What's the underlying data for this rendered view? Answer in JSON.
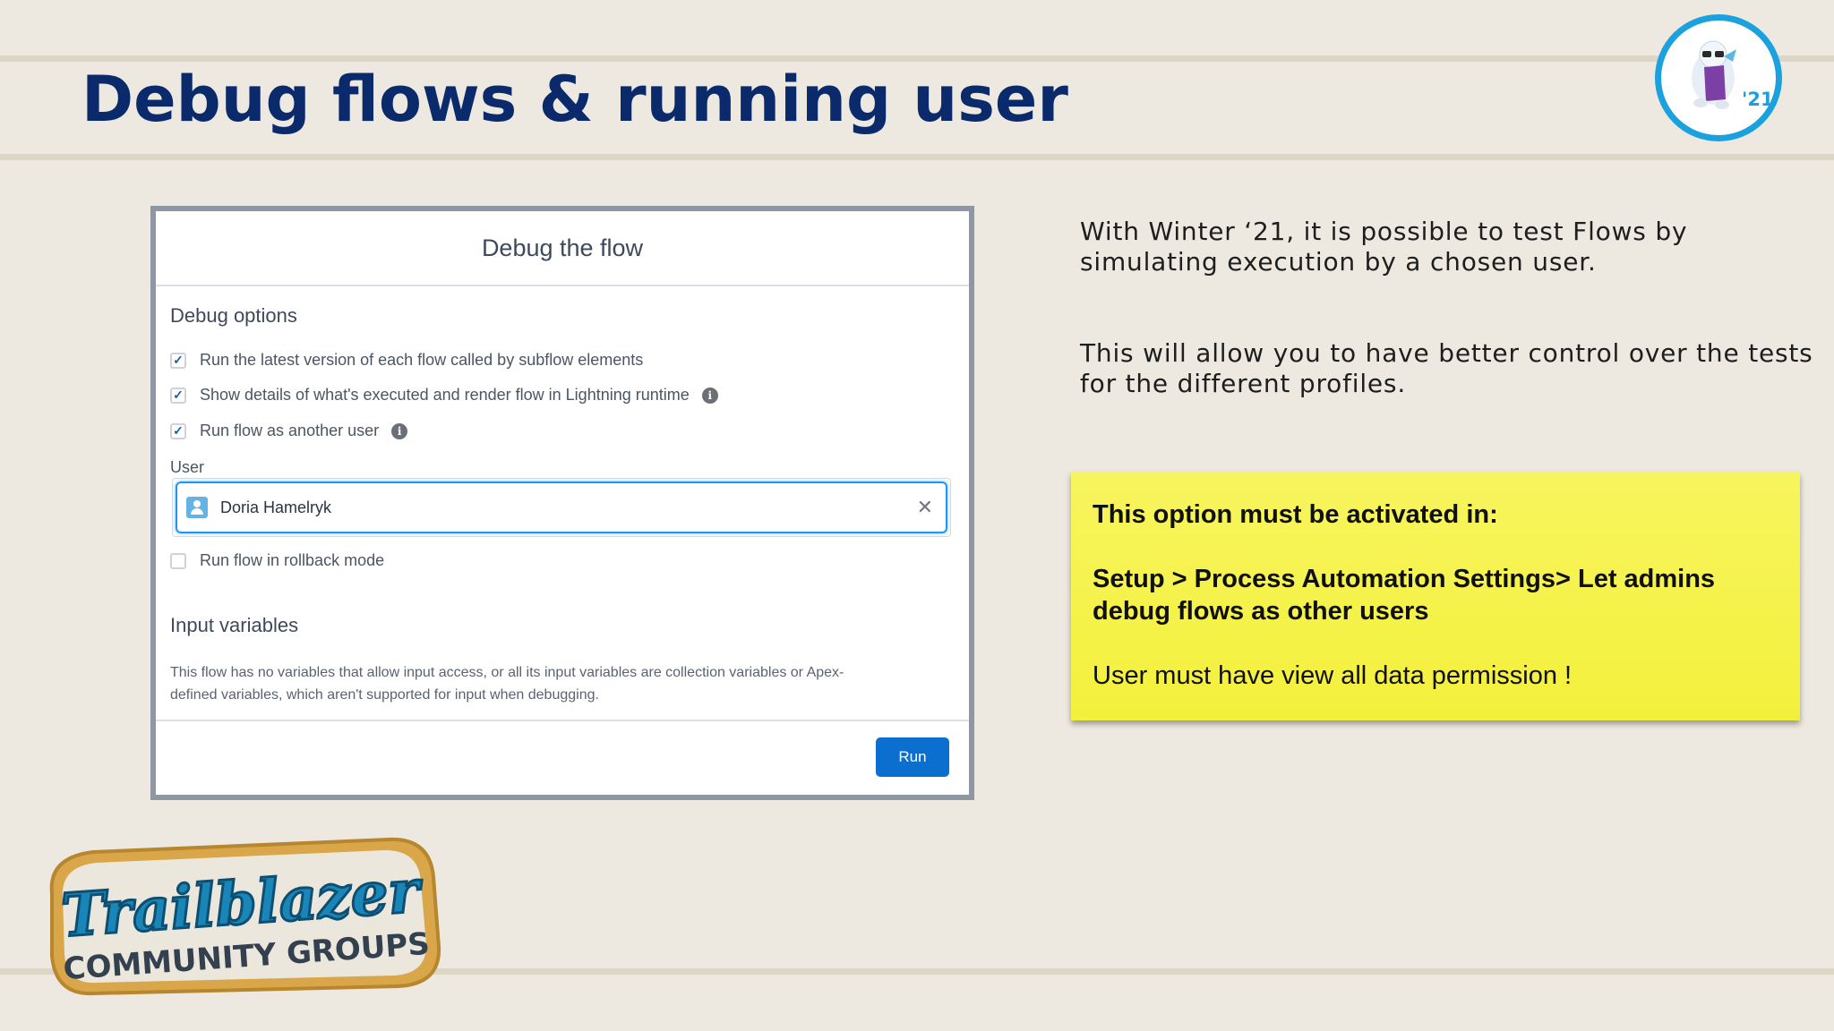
{
  "slide": {
    "title": "Debug flows & running user",
    "badge_year": "'21"
  },
  "dialog": {
    "header": "Debug the flow",
    "debug_options_title": "Debug options",
    "options": [
      {
        "label": "Run the latest version of each flow called by subflow elements",
        "checked": true
      },
      {
        "label": "Show details of what's executed and render flow in Lightning runtime",
        "checked": true
      },
      {
        "label": "Run flow as another user",
        "checked": true
      }
    ],
    "user_label": "User",
    "user_value": "Doria Hamelryk",
    "rollback_label": "Run flow in rollback mode",
    "rollback_checked": false,
    "input_variables_title": "Input variables",
    "input_variables_desc_1": "This flow has no variables that allow input access, or all its input variables are collection variables or Apex-",
    "input_variables_desc_2": "defined variables, which aren't supported for input when debugging.",
    "run_label": "Run"
  },
  "right": {
    "para1_line1": "With Winter ‘21, it is possible to test Flows by",
    "para1_line2": "simulating execution by a chosen user.",
    "para2_line1": "This will allow you to have better control over the tests",
    "para2_line2": "for the different profiles.",
    "note_line1": "This option must be activated in:",
    "note_line2": "Setup > Process Automation Settings> Let admins",
    "note_line3": "debug flows as other users",
    "note_line4": "User must have view all data permission !"
  },
  "logo": {
    "line1": "Trailblazer",
    "line2": "COMMUNITY GROUPS"
  },
  "colors": {
    "title": "#0b2a6b",
    "accent_blue": "#1aa1de",
    "note_yellow": "#f5f34c",
    "run_button": "#0b6fcf"
  }
}
